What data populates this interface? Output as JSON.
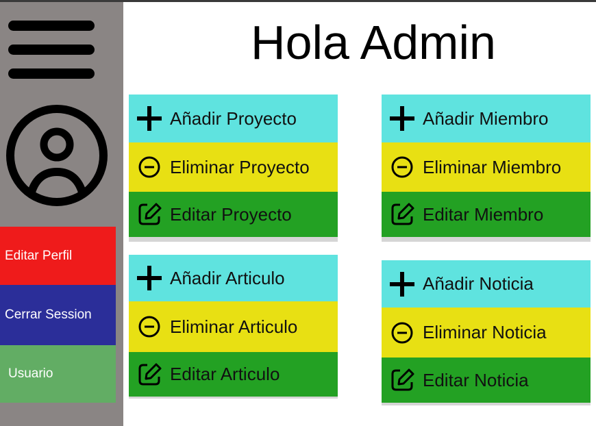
{
  "header": {
    "title": "Hola Admin"
  },
  "sidebar": {
    "buttons": [
      {
        "label": "Editar Perfil",
        "color": "#ef1b1b"
      },
      {
        "label": "Cerrar Session",
        "color": "#2b2e99"
      },
      {
        "label": "Usuario",
        "color": "#62ad64"
      }
    ]
  },
  "cards": {
    "proyecto": {
      "add": "Añadir Proyecto",
      "delete": "Eliminar Proyecto",
      "edit": "Editar Proyecto"
    },
    "miembro": {
      "add": "Añadir Miembro",
      "delete": "Eliminar Miembro",
      "edit": "Editar Miembro"
    },
    "articulo": {
      "add": "Añadir Articulo",
      "delete": "Eliminar Articulo",
      "edit": "Editar Articulo"
    },
    "noticia": {
      "add": "Añadir Noticia",
      "delete": "Eliminar Noticia",
      "edit": "Editar Noticia"
    }
  },
  "icons": {
    "menu": "hamburger-menu-icon",
    "profile": "user-avatar-icon",
    "add": "plus-icon",
    "delete": "minus-circle-icon",
    "edit": "edit-square-icon"
  },
  "colors": {
    "add_row": "#5fe3df",
    "delete_row": "#e8e013",
    "edit_row": "#23a123",
    "sidebar": "#8a8584"
  }
}
